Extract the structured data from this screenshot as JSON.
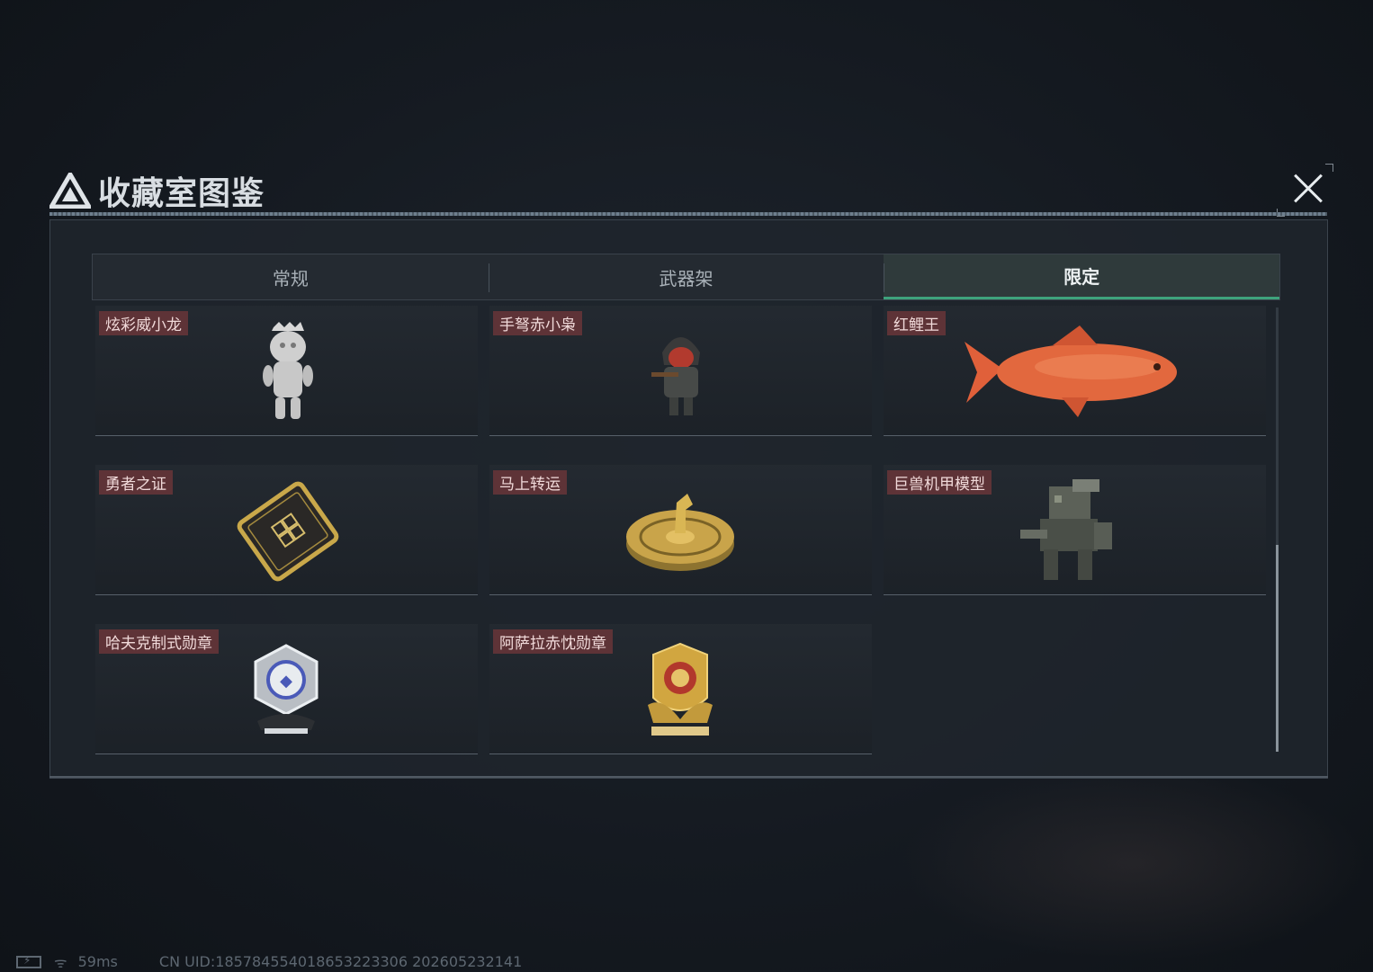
{
  "window": {
    "title": "收藏室图鉴",
    "close_label": "关闭"
  },
  "tabs": [
    {
      "label": "常规",
      "active": false
    },
    {
      "label": "武器架",
      "active": false
    },
    {
      "label": "限定",
      "active": true
    }
  ],
  "items": [
    {
      "label": "炫彩威小龙",
      "icon": "dragon-figurine-icon"
    },
    {
      "label": "手弩赤小枭",
      "icon": "crossbow-figurine-icon"
    },
    {
      "label": "红鲤王",
      "icon": "red-carp-icon"
    },
    {
      "label": "勇者之证",
      "icon": "gold-card-icon"
    },
    {
      "label": "马上转运",
      "icon": "horse-turntable-icon"
    },
    {
      "label": "巨兽机甲模型",
      "icon": "mech-model-icon"
    },
    {
      "label": "哈夫克制式勋章",
      "icon": "silver-medal-icon"
    },
    {
      "label": "阿萨拉赤忱勋章",
      "icon": "gold-medal-icon"
    }
  ],
  "status": {
    "ping": "59ms",
    "uid": "CN UID:1857845540186532233​06 202605232141"
  },
  "colors": {
    "accent_green": "#3ea37c",
    "label_bg": "#5e3337"
  }
}
